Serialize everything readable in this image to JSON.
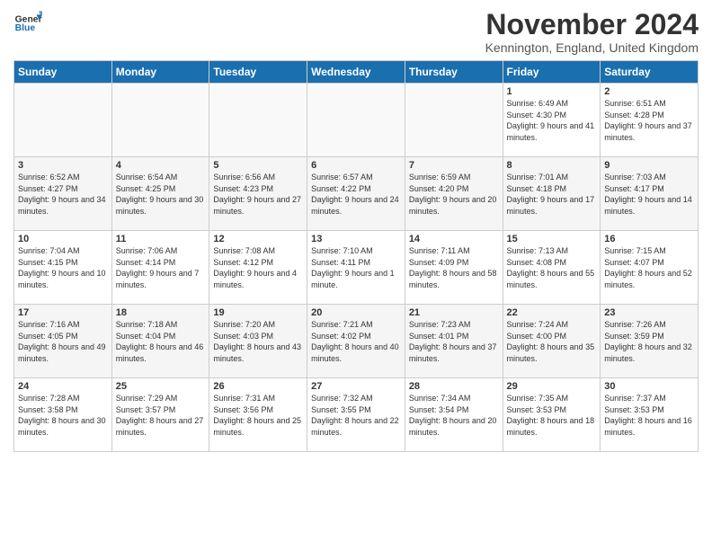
{
  "logo": {
    "line1": "General",
    "line2": "Blue"
  },
  "title": "November 2024",
  "location": "Kennington, England, United Kingdom",
  "days_of_week": [
    "Sunday",
    "Monday",
    "Tuesday",
    "Wednesday",
    "Thursday",
    "Friday",
    "Saturday"
  ],
  "weeks": [
    [
      {
        "day": "",
        "info": ""
      },
      {
        "day": "",
        "info": ""
      },
      {
        "day": "",
        "info": ""
      },
      {
        "day": "",
        "info": ""
      },
      {
        "day": "",
        "info": ""
      },
      {
        "day": "1",
        "info": "Sunrise: 6:49 AM\nSunset: 4:30 PM\nDaylight: 9 hours and 41 minutes."
      },
      {
        "day": "2",
        "info": "Sunrise: 6:51 AM\nSunset: 4:28 PM\nDaylight: 9 hours and 37 minutes."
      }
    ],
    [
      {
        "day": "3",
        "info": "Sunrise: 6:52 AM\nSunset: 4:27 PM\nDaylight: 9 hours and 34 minutes."
      },
      {
        "day": "4",
        "info": "Sunrise: 6:54 AM\nSunset: 4:25 PM\nDaylight: 9 hours and 30 minutes."
      },
      {
        "day": "5",
        "info": "Sunrise: 6:56 AM\nSunset: 4:23 PM\nDaylight: 9 hours and 27 minutes."
      },
      {
        "day": "6",
        "info": "Sunrise: 6:57 AM\nSunset: 4:22 PM\nDaylight: 9 hours and 24 minutes."
      },
      {
        "day": "7",
        "info": "Sunrise: 6:59 AM\nSunset: 4:20 PM\nDaylight: 9 hours and 20 minutes."
      },
      {
        "day": "8",
        "info": "Sunrise: 7:01 AM\nSunset: 4:18 PM\nDaylight: 9 hours and 17 minutes."
      },
      {
        "day": "9",
        "info": "Sunrise: 7:03 AM\nSunset: 4:17 PM\nDaylight: 9 hours and 14 minutes."
      }
    ],
    [
      {
        "day": "10",
        "info": "Sunrise: 7:04 AM\nSunset: 4:15 PM\nDaylight: 9 hours and 10 minutes."
      },
      {
        "day": "11",
        "info": "Sunrise: 7:06 AM\nSunset: 4:14 PM\nDaylight: 9 hours and 7 minutes."
      },
      {
        "day": "12",
        "info": "Sunrise: 7:08 AM\nSunset: 4:12 PM\nDaylight: 9 hours and 4 minutes."
      },
      {
        "day": "13",
        "info": "Sunrise: 7:10 AM\nSunset: 4:11 PM\nDaylight: 9 hours and 1 minute."
      },
      {
        "day": "14",
        "info": "Sunrise: 7:11 AM\nSunset: 4:09 PM\nDaylight: 8 hours and 58 minutes."
      },
      {
        "day": "15",
        "info": "Sunrise: 7:13 AM\nSunset: 4:08 PM\nDaylight: 8 hours and 55 minutes."
      },
      {
        "day": "16",
        "info": "Sunrise: 7:15 AM\nSunset: 4:07 PM\nDaylight: 8 hours and 52 minutes."
      }
    ],
    [
      {
        "day": "17",
        "info": "Sunrise: 7:16 AM\nSunset: 4:05 PM\nDaylight: 8 hours and 49 minutes."
      },
      {
        "day": "18",
        "info": "Sunrise: 7:18 AM\nSunset: 4:04 PM\nDaylight: 8 hours and 46 minutes."
      },
      {
        "day": "19",
        "info": "Sunrise: 7:20 AM\nSunset: 4:03 PM\nDaylight: 8 hours and 43 minutes."
      },
      {
        "day": "20",
        "info": "Sunrise: 7:21 AM\nSunset: 4:02 PM\nDaylight: 8 hours and 40 minutes."
      },
      {
        "day": "21",
        "info": "Sunrise: 7:23 AM\nSunset: 4:01 PM\nDaylight: 8 hours and 37 minutes."
      },
      {
        "day": "22",
        "info": "Sunrise: 7:24 AM\nSunset: 4:00 PM\nDaylight: 8 hours and 35 minutes."
      },
      {
        "day": "23",
        "info": "Sunrise: 7:26 AM\nSunset: 3:59 PM\nDaylight: 8 hours and 32 minutes."
      }
    ],
    [
      {
        "day": "24",
        "info": "Sunrise: 7:28 AM\nSunset: 3:58 PM\nDaylight: 8 hours and 30 minutes."
      },
      {
        "day": "25",
        "info": "Sunrise: 7:29 AM\nSunset: 3:57 PM\nDaylight: 8 hours and 27 minutes."
      },
      {
        "day": "26",
        "info": "Sunrise: 7:31 AM\nSunset: 3:56 PM\nDaylight: 8 hours and 25 minutes."
      },
      {
        "day": "27",
        "info": "Sunrise: 7:32 AM\nSunset: 3:55 PM\nDaylight: 8 hours and 22 minutes."
      },
      {
        "day": "28",
        "info": "Sunrise: 7:34 AM\nSunset: 3:54 PM\nDaylight: 8 hours and 20 minutes."
      },
      {
        "day": "29",
        "info": "Sunrise: 7:35 AM\nSunset: 3:53 PM\nDaylight: 8 hours and 18 minutes."
      },
      {
        "day": "30",
        "info": "Sunrise: 7:37 AM\nSunset: 3:53 PM\nDaylight: 8 hours and 16 minutes."
      }
    ]
  ]
}
